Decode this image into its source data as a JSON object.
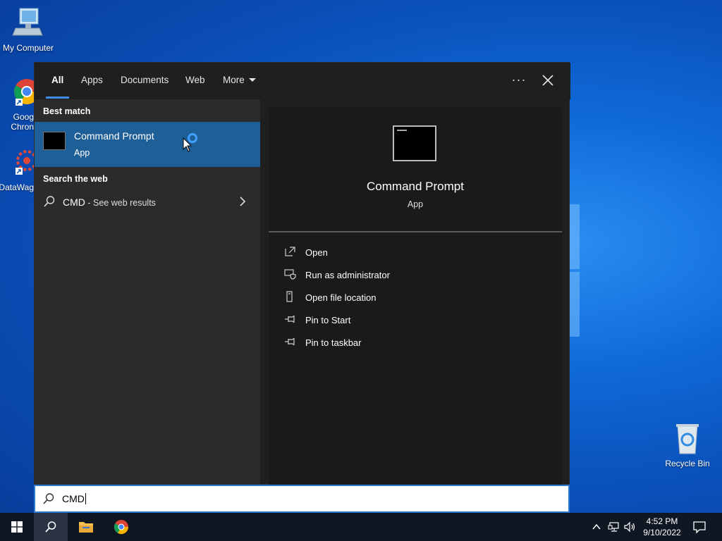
{
  "desktop": {
    "icons": {
      "my_computer": "My Computer",
      "chrome_line1": "Goog",
      "chrome_line2": "Chron",
      "datawag": "DataWag",
      "recycle_bin": "Recycle Bin"
    }
  },
  "search_panel": {
    "tabs": {
      "all": "All",
      "apps": "Apps",
      "documents": "Documents",
      "web": "Web",
      "more": "More"
    },
    "overflow": "···",
    "best_match_label": "Best match",
    "best_match": {
      "name": "Command Prompt",
      "type": "App"
    },
    "search_web_label": "Search the web",
    "web_result": {
      "query": "CMD",
      "suffix": " - See web results"
    },
    "preview": {
      "name": "Command Prompt",
      "type": "App",
      "actions": {
        "open": "Open",
        "run_admin": "Run as administrator",
        "open_location": "Open file location",
        "pin_start": "Pin to Start",
        "pin_taskbar": "Pin to taskbar"
      }
    }
  },
  "search_box": {
    "value": "CMD"
  },
  "taskbar": {
    "time": "4:52 PM",
    "date": "9/10/2022"
  },
  "colors": {
    "accent": "#3d8ee6",
    "selected_row": "#1f5f97",
    "panel_bg": "#1f1f1f"
  }
}
